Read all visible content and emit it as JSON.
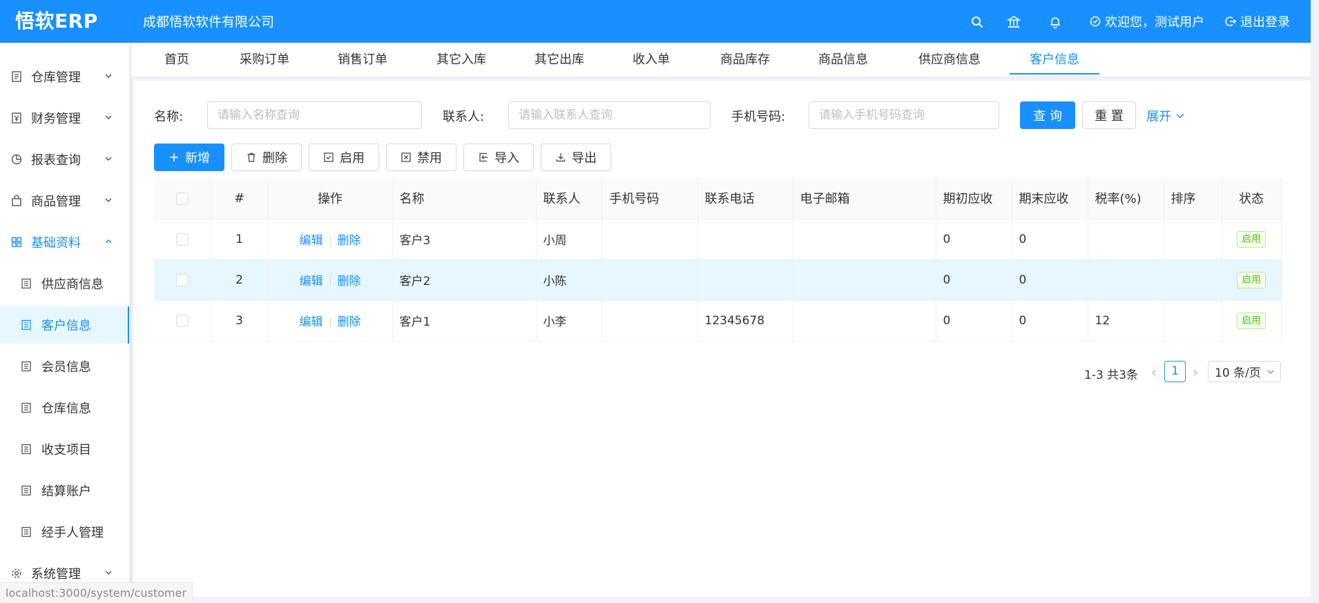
{
  "header": {
    "logo": "悟软ERP",
    "company": "成都悟软软件有限公司",
    "welcome": "欢迎您，测试用户",
    "logout": "退出登录"
  },
  "sidebar": {
    "groups": [
      {
        "label": "仓库管理",
        "icon": "warehouse-icon"
      },
      {
        "label": "财务管理",
        "icon": "finance-icon"
      },
      {
        "label": "报表查询",
        "icon": "pie-chart-icon"
      },
      {
        "label": "商品管理",
        "icon": "bag-icon"
      },
      {
        "label": "基础资料",
        "icon": "grid-icon"
      },
      {
        "label": "系统管理",
        "icon": "gear-icon"
      }
    ],
    "sub_items": [
      "供应商信息",
      "客户信息",
      "会员信息",
      "仓库信息",
      "收支项目",
      "结算账户",
      "经手人管理"
    ],
    "active_sub": "客户信息"
  },
  "tabs": [
    "首页",
    "采购订单",
    "销售订单",
    "其它入库",
    "其它出库",
    "收入单",
    "商品库存",
    "商品信息",
    "供应商信息",
    "客户信息"
  ],
  "active_tab": "客户信息",
  "filters": {
    "name_label": "名称:",
    "name_placeholder": "请输入名称查询",
    "contact_label": "联系人:",
    "contact_placeholder": "请输入联系人查询",
    "phone_label": "手机号码:",
    "phone_placeholder": "请输入手机号码查询",
    "query": "查 询",
    "reset": "重 置",
    "expand": "展开"
  },
  "toolbar": {
    "add": "新增",
    "delete": "删除",
    "enable": "启用",
    "disable": "禁用",
    "import": "导入",
    "export": "导出"
  },
  "table": {
    "columns": [
      "#",
      "操作",
      "名称",
      "联系人",
      "手机号码",
      "联系电话",
      "电子邮箱",
      "期初应收",
      "期末应收",
      "税率(%)",
      "排序",
      "状态"
    ],
    "edit_label": "编辑",
    "delete_label": "删除",
    "rows": [
      {
        "no": "1",
        "name": "客户3",
        "contact": "小周",
        "mobile": "",
        "phone": "",
        "email": "",
        "begin": "0",
        "end": "0",
        "tax": "",
        "sort": "",
        "status": "启用"
      },
      {
        "no": "2",
        "name": "客户2",
        "contact": "小陈",
        "mobile": "",
        "phone": "",
        "email": "",
        "begin": "0",
        "end": "0",
        "tax": "",
        "sort": "",
        "status": "启用"
      },
      {
        "no": "3",
        "name": "客户1",
        "contact": "小李",
        "mobile": "",
        "phone": "12345678",
        "email": "",
        "begin": "0",
        "end": "0",
        "tax": "12",
        "sort": "",
        "status": "启用"
      }
    ]
  },
  "pagination": {
    "total": "1-3 共3条",
    "current": "1",
    "page_size": "10 条/页"
  },
  "statusbar": {
    "url": "localhost:3000/system/customer"
  },
  "colors": {
    "primary": "#1890ff",
    "success": "#52c41a"
  }
}
